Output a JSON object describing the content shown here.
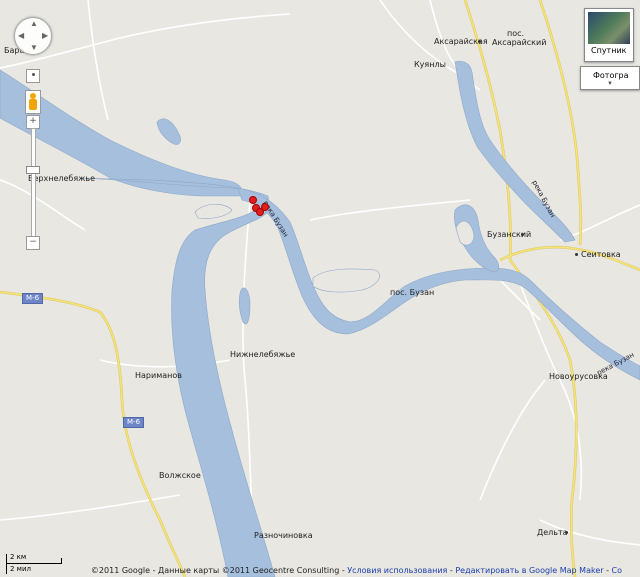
{
  "map": {
    "colors": {
      "land": "#e9e7e2",
      "water": "#a5bfdd",
      "road_major": "#f6e47a",
      "road_minor": "#ffffff"
    },
    "labels": {
      "aksaraiskaya": "Аксарайская",
      "pos_aksaraisky_1": "пос.",
      "pos_aksaraisky_2": "Аксарайский",
      "kuyanly": "Куянлы",
      "bara": "Бара",
      "verkhnelebyazhye": "Верхнелебяжье",
      "buzansky": "Бузанский",
      "seitovka": "Сеитовка",
      "pos_buzan": "пос. Бузан",
      "nizhnelebyazhye": "Нижнелебяжье",
      "narimanov": "Нариманов",
      "novourusovka": "Новоурусовка",
      "volzhskoe": "Волжское",
      "raznochinovka": "Разночиновка",
      "delta": "Дельта"
    },
    "river_labels": {
      "buzan_top": "река Бузан",
      "buzan_mid": "река Бузан",
      "buzan_right": "река Бузан"
    },
    "road_shields": {
      "m6_upper": "М-6",
      "m6_lower": "М-6"
    },
    "markers": [
      "marker",
      "marker",
      "marker",
      "marker"
    ]
  },
  "controls": {
    "zoom_in": "+",
    "zoom_out": "−",
    "satellite_label": "Спутник",
    "photos_label": "Фотогра"
  },
  "footer": {
    "copyright": "©2011 Google - Данные карты ©2011 Geocentre Consulting - ",
    "terms_link": "Условия использования",
    "sep": " - ",
    "edit_link": "Редактировать в Google Map Maker",
    "error_link": "Со"
  },
  "scale": {
    "km": "2 км",
    "mi": "2 мил"
  }
}
